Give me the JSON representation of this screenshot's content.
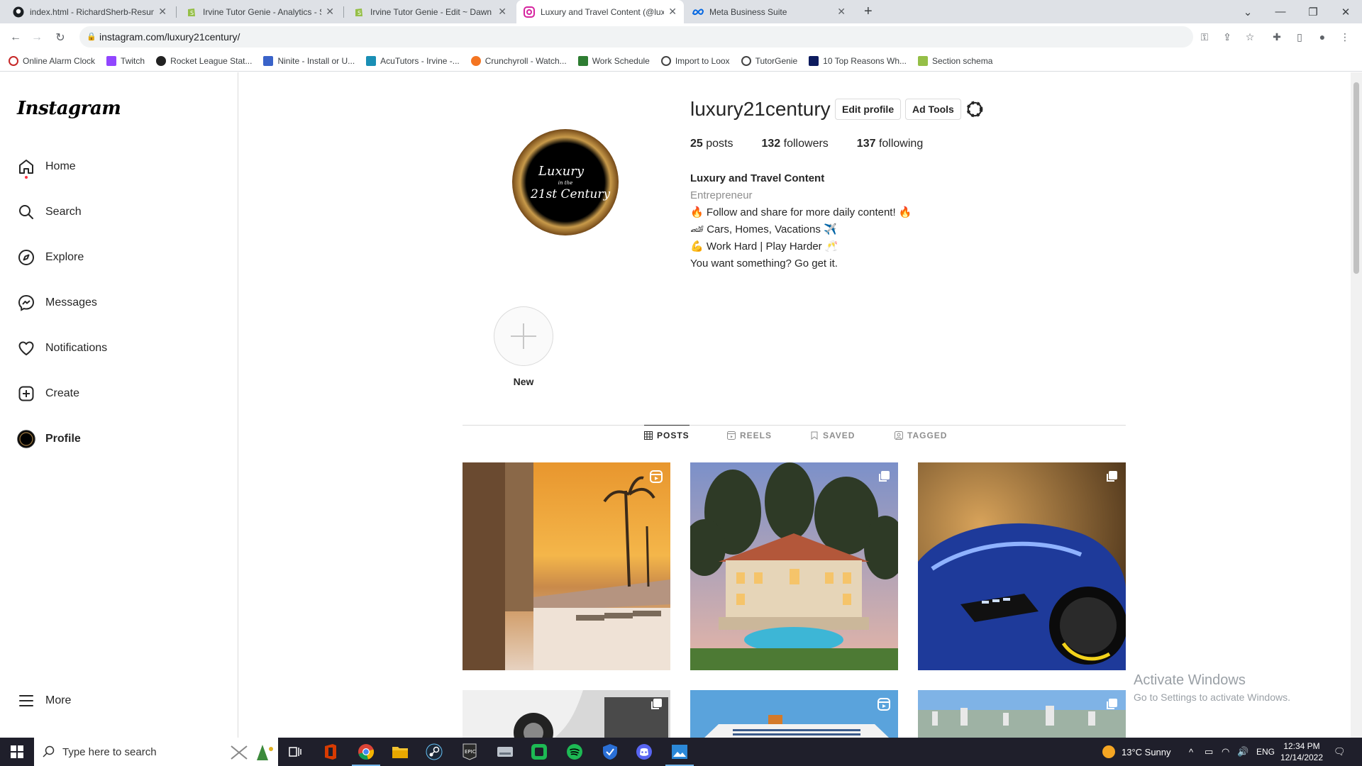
{
  "browser": {
    "tabs": [
      {
        "title": "index.html - RichardSherb-Resum",
        "icon": "github-icon"
      },
      {
        "title": "Irvine Tutor Genie - Analytics - Sh",
        "icon": "shopify-icon"
      },
      {
        "title": "Irvine Tutor Genie - Edit ~ Dawn",
        "icon": "shopify-icon"
      },
      {
        "title": "Luxury and Travel Content (@luxu",
        "icon": "instagram-icon"
      },
      {
        "title": "Meta Business Suite",
        "icon": "meta-icon"
      }
    ],
    "active_tab": 3,
    "url": "instagram.com/luxury21century/",
    "bookmarks": [
      {
        "label": "Online Alarm Clock",
        "color": "#c62828"
      },
      {
        "label": "Twitch",
        "color": "#9146ff"
      },
      {
        "label": "Rocket League Stat...",
        "color": "#222222"
      },
      {
        "label": "Ninite - Install or U...",
        "color": "#3a63c9"
      },
      {
        "label": "AcuTutors - Irvine -...",
        "color": "#1a8fb5"
      },
      {
        "label": "Crunchyroll - Watch...",
        "color": "#f47521"
      },
      {
        "label": "Work Schedule",
        "color": "#2e7d32"
      },
      {
        "label": "Import to Loox",
        "color": "#444444"
      },
      {
        "label": "TutorGenie",
        "color": "#444444"
      },
      {
        "label": "10 Top Reasons Wh...",
        "color": "#0d1b5e"
      },
      {
        "label": "Section schema",
        "color": "#95bf47"
      }
    ]
  },
  "sidebar": {
    "logo": "Instagram",
    "items": [
      {
        "label": "Home",
        "icon": "home-icon"
      },
      {
        "label": "Search",
        "icon": "search-icon"
      },
      {
        "label": "Explore",
        "icon": "compass-icon"
      },
      {
        "label": "Messages",
        "icon": "messenger-icon"
      },
      {
        "label": "Notifications",
        "icon": "heart-icon"
      },
      {
        "label": "Create",
        "icon": "plus-square-icon"
      },
      {
        "label": "Profile",
        "icon": "profile-avatar-icon"
      }
    ],
    "more_label": "More"
  },
  "profile": {
    "username": "luxury21century",
    "edit_profile_label": "Edit profile",
    "ad_tools_label": "Ad Tools",
    "avatar_text": {
      "line1": "Luxury",
      "line2": "in the",
      "line3": "21st Century"
    },
    "stats": {
      "posts_count": "25",
      "posts_label": "posts",
      "followers_count": "132",
      "followers_label": "followers",
      "following_count": "137",
      "following_label": "following"
    },
    "full_name": "Luxury and Travel Content",
    "category": "Entrepreneur",
    "bio_lines": [
      "🔥 Follow and share for more daily content! 🔥",
      "🏎 Cars, Homes, Vacations ✈️",
      "💪 Work Hard | Play Harder 🥂",
      "You want something? Go get it."
    ],
    "new_highlight_label": "New"
  },
  "profile_tabs": [
    {
      "label": "POSTS",
      "icon": "grid-icon",
      "active": true
    },
    {
      "label": "REELS",
      "icon": "reels-icon",
      "active": false
    },
    {
      "label": "SAVED",
      "icon": "bookmark-icon",
      "active": false
    },
    {
      "label": "TAGGED",
      "icon": "tagged-icon",
      "active": false
    }
  ],
  "posts": [
    {
      "subject": "sunset pool terrace",
      "badge": "reel-icon"
    },
    {
      "subject": "mansion with pool",
      "badge": "carousel-icon"
    },
    {
      "subject": "blue supercar",
      "badge": "carousel-icon"
    },
    {
      "subject": "luxury car interior",
      "badge": "carousel-icon"
    },
    {
      "subject": "cruise ship",
      "badge": "reel-icon"
    },
    {
      "subject": "city skyline",
      "badge": "carousel-icon"
    }
  ],
  "watermark": {
    "title": "Activate Windows",
    "subtitle": "Go to Settings to activate Windows."
  },
  "taskbar": {
    "search_placeholder": "Type here to search",
    "weather": "13°C  Sunny",
    "language": "ENG",
    "time": "12:34 PM",
    "date": "12/14/2022"
  }
}
